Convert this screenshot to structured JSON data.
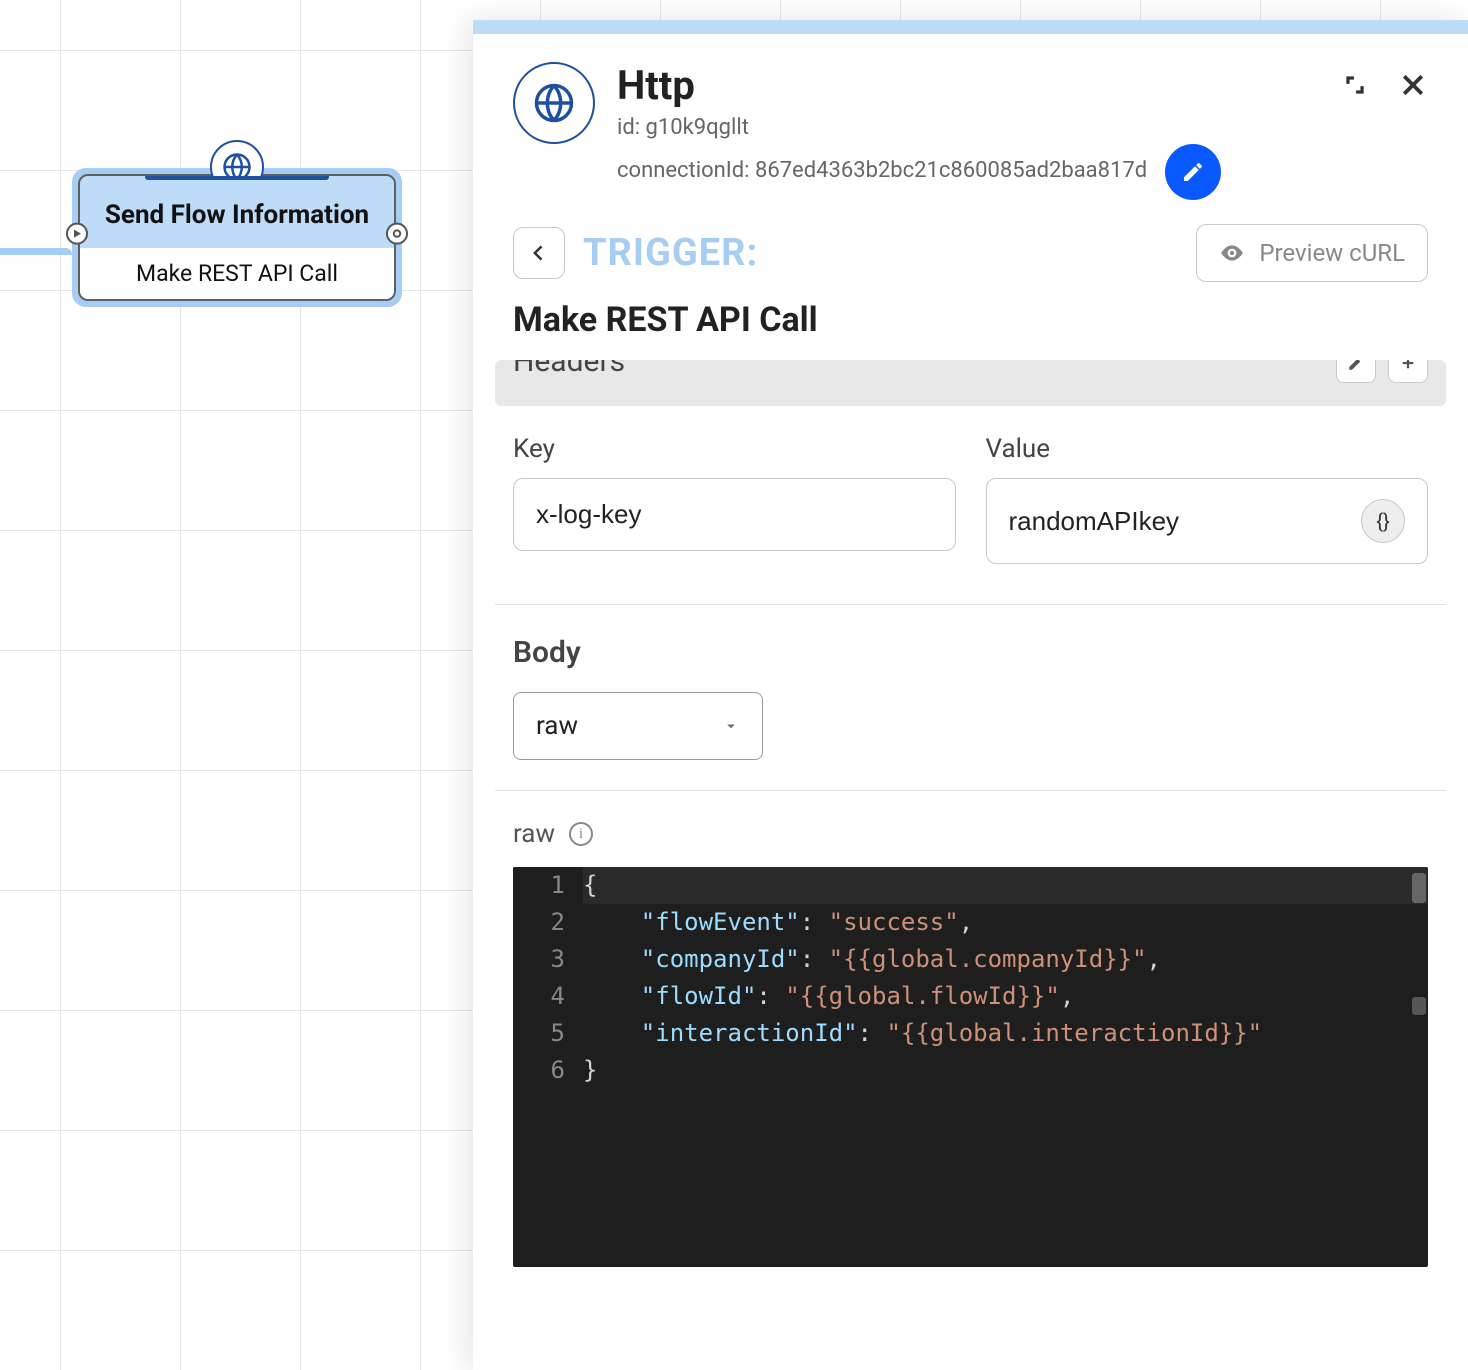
{
  "canvas": {
    "node": {
      "title": "Send Flow Information",
      "subtitle": "Make REST API Call",
      "icon": "globe-icon"
    }
  },
  "panel": {
    "icon": "globe-icon",
    "title": "Http",
    "id_label": "id: g10k9qgllt",
    "connection_label": "connectionId: 867ed4363b2bc21c860085ad2baa817d",
    "trigger_label": "TRIGGER:",
    "preview_label": "Preview cURL",
    "action_title": "Make REST API Call",
    "headers_label": "Headers",
    "kv": {
      "key_label": "Key",
      "value_label": "Value",
      "key_value": "x-log-key",
      "value_value": "randomAPIkey"
    },
    "body": {
      "label": "Body",
      "select_value": "raw"
    },
    "raw": {
      "label": "raw",
      "code_lines": [
        "{",
        "    \"flowEvent\": \"success\",",
        "    \"companyId\": \"{{global.companyId}}\",",
        "    \"flowId\": \"{{global.flowId}}\",",
        "    \"interactionId\": \"{{global.interactionId}}\"",
        "}"
      ]
    }
  }
}
